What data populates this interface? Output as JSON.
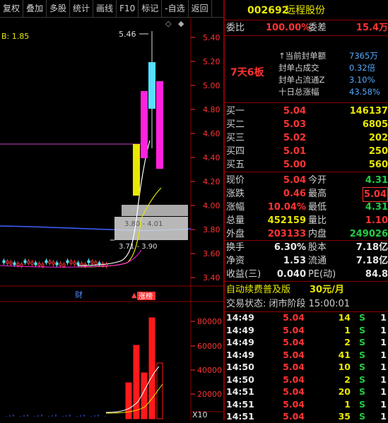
{
  "toolbar": [
    "复权",
    "叠加",
    "多股",
    "统计",
    "画线",
    "F10",
    "标记",
    "-自选",
    "返回"
  ],
  "chart": {
    "ma_label": "B: 1.85",
    "price_ticks": [
      "5.40",
      "5.20",
      "5.00",
      "4.80",
      "4.60",
      "4.40",
      "4.20",
      "4.00",
      "3.80",
      "3.60",
      "3.40"
    ],
    "vol_ticks": [
      "80000",
      "60000",
      "40000",
      "20000"
    ],
    "vol_unit": "X10",
    "high_label": "5.46",
    "range_label_1": "3.80 - 4.01",
    "range_label_2": "3.71 - 3.90",
    "marker_cai": "财",
    "marker_zhangbang": "涨榜"
  },
  "stock": {
    "code": "002692",
    "name": "远程股份",
    "weibi_label": "委比",
    "weibi": "100.00%",
    "weicha_label": "委差",
    "weicha": "15.4万",
    "streak": "7天6板",
    "seal_info": [
      {
        "label": "↑当前封单额",
        "value": "7365万"
      },
      {
        "label": "封单占成交",
        "value": "0.32倍"
      },
      {
        "label": "封单占流通Z",
        "value": "3.10%"
      },
      {
        "label": "十日总涨幅",
        "value": "43.58%"
      }
    ],
    "bids": [
      {
        "label": "买一",
        "price": "5.04",
        "vol": "146137"
      },
      {
        "label": "买二",
        "price": "5.03",
        "vol": "6805"
      },
      {
        "label": "买三",
        "price": "5.02",
        "vol": "202"
      },
      {
        "label": "买四",
        "price": "5.01",
        "vol": "250"
      },
      {
        "label": "买五",
        "price": "5.00",
        "vol": "560"
      }
    ],
    "quote": [
      {
        "l1": "现价",
        "v1": "5.04",
        "l2": "今开",
        "v2": "4.31"
      },
      {
        "l1": "涨跌",
        "v1": "0.46",
        "l2": "最高",
        "v2": "5.04"
      },
      {
        "l1": "涨幅",
        "v1": "10.04%",
        "l2": "最低",
        "v2": "4.31"
      },
      {
        "l1": "总量",
        "v1": "452159",
        "l2": "量比",
        "v2": "1.10"
      },
      {
        "l1": "外盘",
        "v1": "203133",
        "l2": "内盘",
        "v2": "249026"
      }
    ],
    "fund": [
      {
        "l1": "换手",
        "v1": "6.30%",
        "l2": "股本",
        "v2": "7.18亿"
      },
      {
        "l1": "净资",
        "v1": "1.53",
        "l2": "流通",
        "v2": "7.18亿"
      },
      {
        "l1": "收益(三)",
        "v1": "0.040",
        "l2": "PE(动)",
        "v2": "84.8"
      }
    ],
    "promo": "自动续费普及版",
    "promo_price": "30元/月",
    "status": "交易状态: 闭市阶段 15:00:01",
    "ticks": [
      {
        "time": "14:49",
        "price": "5.04",
        "vol": "14",
        "side": "S",
        "n": "1"
      },
      {
        "time": "14:49",
        "price": "5.04",
        "vol": "1",
        "side": "S",
        "n": "1"
      },
      {
        "time": "14:49",
        "price": "5.04",
        "vol": "2",
        "side": "S",
        "n": "1"
      },
      {
        "time": "14:49",
        "price": "5.04",
        "vol": "41",
        "side": "S",
        "n": "1"
      },
      {
        "time": "14:50",
        "price": "5.04",
        "vol": "10",
        "side": "S",
        "n": "1"
      },
      {
        "time": "14:50",
        "price": "5.04",
        "vol": "2",
        "side": "S",
        "n": "1"
      },
      {
        "time": "14:51",
        "price": "5.04",
        "vol": "20",
        "side": "S",
        "n": "1"
      },
      {
        "time": "14:51",
        "price": "5.04",
        "vol": "1",
        "side": "S",
        "n": "1"
      },
      {
        "time": "14:51",
        "price": "5.04",
        "vol": "35",
        "side": "S",
        "n": "1"
      }
    ]
  },
  "colors": {
    "up": "#ff3333",
    "down": "#22cc44",
    "cyan": "#55e0ff",
    "magenta": "#ff22dd",
    "yellow": "#e8e800"
  }
}
